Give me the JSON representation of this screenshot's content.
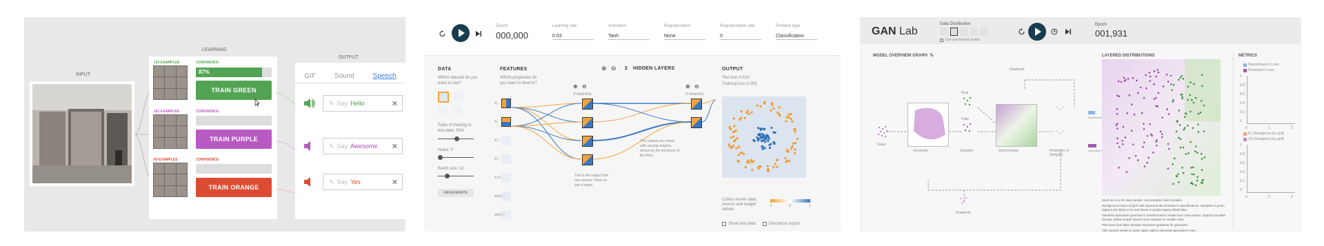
{
  "panel1": {
    "input_label": "INPUT",
    "learning_label": "LEARNING",
    "output_label": "OUTPUT",
    "classes": [
      {
        "examples": "123 EXAMPLES",
        "confidence_label": "CONFIDENCE",
        "confidence": "87%",
        "confidence_fraction": 0.87,
        "button": "TRAIN GREEN",
        "color": "#52a454",
        "say_prefix": "Say",
        "say_word": "Hello",
        "word_color": "#4a9a4c"
      },
      {
        "examples": "101 EXAMPLES",
        "confidence_label": "CONFIDENCE",
        "confidence": "",
        "confidence_fraction": 0,
        "button": "TRAIN PURPLE",
        "color": "#b85ac2",
        "say_prefix": "Say",
        "say_word": "Awesome",
        "word_color": "#b04cbd"
      },
      {
        "examples": "83 EXAMPLES",
        "confidence_label": "CONFIDENCE",
        "confidence": "",
        "confidence_fraction": 0,
        "button": "TRAIN ORANGE",
        "color": "#dc4c33",
        "say_prefix": "Say",
        "say_word": "Yes",
        "word_color": "#d04a2f"
      }
    ],
    "output_tabs": [
      "GIF",
      "Sound",
      "Speech"
    ],
    "active_tab": "Speech"
  },
  "panel2": {
    "controls": [
      {
        "label": "Epoch",
        "value": "000,000"
      },
      {
        "label": "Learning rate",
        "value": "0.03"
      },
      {
        "label": "Activation",
        "value": "Tanh"
      },
      {
        "label": "Regularization",
        "value": "None"
      },
      {
        "label": "Regularization rate",
        "value": "0"
      },
      {
        "label": "Problem type",
        "value": "Classification"
      }
    ],
    "data_title": "DATA",
    "data_question": "Which dataset do you want to use?",
    "ratio_label": "Ratio of training to test data:  50%",
    "noise_label": "Noise:  0",
    "batch_label": "Batch size:  10",
    "regenerate": "REGENERATE",
    "features_title": "FEATURES",
    "features_question": "Which properties do you want to feed in?",
    "features": [
      "X₁",
      "X₂",
      "X₁²",
      "X₂²",
      "X₁X₂",
      "sin(X₁)",
      "sin(X₂)"
    ],
    "layers_count": "2",
    "layers_label": "HIDDEN LAYERS",
    "layer1_neurons": "4 neurons",
    "layer2_neurons": "2 neurons",
    "note_outputs": "The outputs are mixed with varying weights, shown by the thickness of the lines.",
    "note_neuron": "This is the output from one neuron. Hover to see it larger.",
    "output_title": "OUTPUT",
    "test_loss": "Test loss 0.510",
    "training_loss": "Training loss 0.503",
    "legend_text": "Colors shows data, neuron and weight values.",
    "legend_ticks": [
      "-1",
      "0",
      "1"
    ],
    "show_test": "Show test data",
    "discretize": "Discretize output"
  },
  "panel3": {
    "title_bold": "GAN",
    "title_rest": "Lab",
    "data_dist_label": "Data Distribution",
    "pretrained": "Use pre-trained model",
    "epoch_label": "Epoch",
    "epoch_value": "001,931",
    "overview_title": "MODEL OVERVIEW GRAPH",
    "layered_title": "LAYERED DISTRIBUTIONS",
    "metrics_title": "METRICS",
    "nodes": {
      "noise": "Noise",
      "generator": "Generator",
      "samples": "Samples",
      "discriminator": "Discriminator",
      "prediction": "Prediction of Samples",
      "real": "Real",
      "fake": "Fake",
      "gradients_top": "Gradients",
      "gradients_bottom": "Gradients",
      "disc_loss": "Discriminator loss",
      "gen_loss": "Generator loss"
    },
    "metrics_legend": [
      "Discriminator's Loss",
      "Generator's Loss",
      "KL Divergence (by grid)",
      "JS Divergence (by grid)"
    ],
    "metrics_y": [
      "1",
      "0.8",
      "0.6",
      "0.4",
      "0.2",
      "0"
    ],
    "metrics_x": [
      "0",
      "1",
      "2"
    ],
    "metrics2_y": [
      "1",
      "0.8",
      "0.6",
      "0.4",
      "0.2",
      "0"
    ],
    "metrics2_x": [
      "0",
      "1",
      "2"
    ],
    "desc": [
      "Each dot is a 2D data sample: real samples; fake samples.",
      "Background colors of grid cells represent discriminator's classifications. Samples in green regions are likely to be real; those in purple regions likely fake.",
      "Manifold represents generator's transformation results from noise space. Opacity encodes density: darker purple means more samples in smaller area.",
      "Pink lines from fake samples represent gradients for generator.",
      "This sample needs to move upper right to decrease generator's loss."
    ]
  }
}
